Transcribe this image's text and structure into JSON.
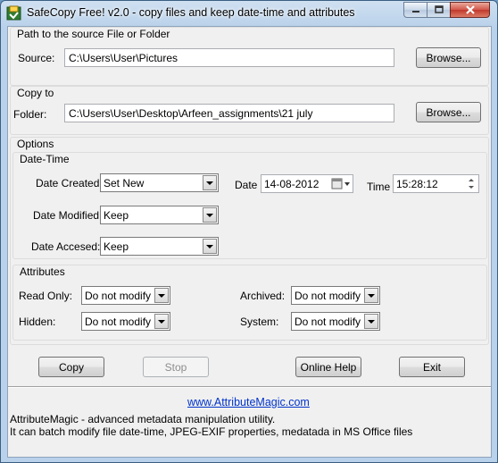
{
  "window": {
    "title": "SafeCopy Free! v2.0 - copy files and keep date-time and attributes",
    "minimize_icon": "minimize-icon",
    "maximize_icon": "maximize-icon",
    "close_icon": "close-icon"
  },
  "source_group": {
    "title": "Path to the source File or Folder",
    "label": "Source:",
    "value": "C:\\Users\\User\\Pictures",
    "browse_label": "Browse..."
  },
  "copyto_group": {
    "title": "Copy to",
    "label": "Folder:",
    "value": "C:\\Users\\User\\Desktop\\Arfeen_assignments\\21 july",
    "browse_label": "Browse..."
  },
  "options": {
    "title": "Options",
    "datetime": {
      "title": "Date-Time",
      "date_created_label": "Date Created:",
      "date_created_value": "Set New",
      "date_label": "Date",
      "date_value": "14-08-2012",
      "time_label": "Time",
      "time_value": "15:28:12",
      "date_modified_label": "Date Modified:",
      "date_modified_value": "Keep",
      "date_accessed_label": "Date Accesed:",
      "date_accessed_value": "Keep"
    },
    "attributes": {
      "title": "Attributes",
      "read_only_label": "Read Only:",
      "read_only_value": "Do not modify",
      "archived_label": "Archived:",
      "archived_value": "Do not modify",
      "hidden_label": "Hidden:",
      "hidden_value": "Do not modify",
      "system_label": "System:",
      "system_value": "Do not modify"
    }
  },
  "buttons": {
    "copy": "Copy",
    "stop": "Stop",
    "online_help": "Online Help",
    "exit": "Exit"
  },
  "footer": {
    "link": "www.AttributeMagic.com",
    "line1": "AttributeMagic - advanced metadata manipulation utility.",
    "line2": "It can batch modify file date-time, JPEG-EXIF properties, medatada in MS Office files"
  }
}
